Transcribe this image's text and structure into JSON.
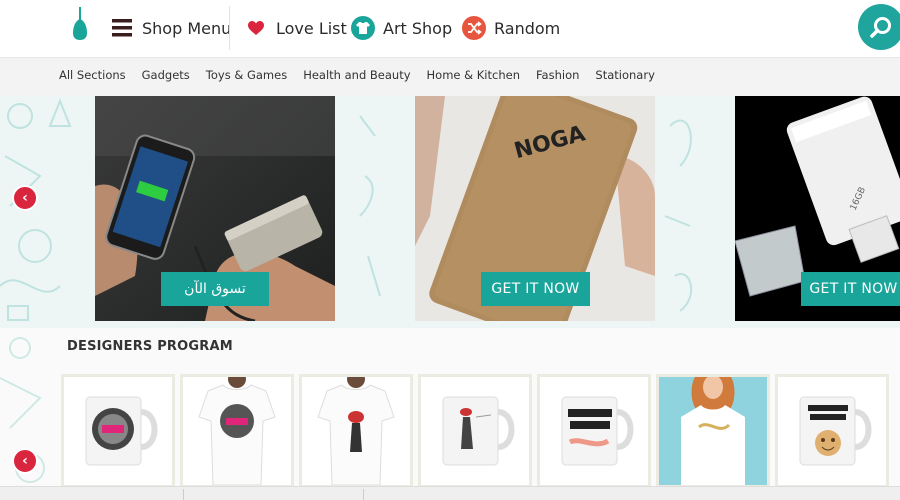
{
  "header": {
    "nav": [
      {
        "label": "Shop Menu",
        "icon": "hamburger-menu-icon"
      },
      {
        "label": "Love List",
        "icon": "heart-icon"
      },
      {
        "label": "Art Shop",
        "icon": "tshirt-icon"
      },
      {
        "label": "Random",
        "icon": "shuffle-icon"
      }
    ],
    "search_icon": "search-icon"
  },
  "subnav": {
    "items": [
      "All Sections",
      "Gadgets",
      "Toys & Games",
      "Health and Beauty",
      "Home & Kitchen",
      "Fashion",
      "Stationary"
    ]
  },
  "banner": {
    "slides": [
      {
        "cta": "تسوق الآن",
        "product": "power bank charging phone"
      },
      {
        "cta": "GET IT NOW",
        "product": "NOGA power bank",
        "brand": "NOGA"
      },
      {
        "cta": "GET IT NOW",
        "product": "USB flash drive",
        "capacity": "16GB"
      }
    ]
  },
  "designers": {
    "title": "DESIGNERS PROGRAM"
  },
  "colors": {
    "accent": "#1aa59a",
    "arrow": "#d9263e",
    "heart": "#d9263e",
    "random": "#e8553e"
  }
}
